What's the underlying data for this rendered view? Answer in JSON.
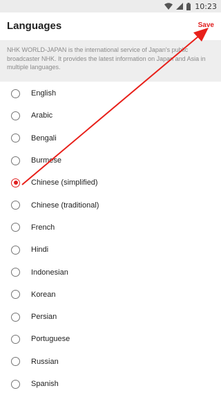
{
  "status_bar": {
    "time": "10:23"
  },
  "toolbar": {
    "title": "Languages",
    "save_label": "Save"
  },
  "description": "NHK WORLD-JAPAN is the international service of Japan's public broadcaster NHK. It provides the latest information on Japan and Asia in multiple languages.",
  "languages": {
    "selected": "Chinese (simplified)",
    "items": [
      {
        "label": "English",
        "checked": false
      },
      {
        "label": "Arabic",
        "checked": false
      },
      {
        "label": "Bengali",
        "checked": false
      },
      {
        "label": "Burmese",
        "checked": false
      },
      {
        "label": "Chinese (simplified)",
        "checked": true
      },
      {
        "label": "Chinese (traditional)",
        "checked": false
      },
      {
        "label": "French",
        "checked": false
      },
      {
        "label": "Hindi",
        "checked": false
      },
      {
        "label": "Indonesian",
        "checked": false
      },
      {
        "label": "Korean",
        "checked": false
      },
      {
        "label": "Persian",
        "checked": false
      },
      {
        "label": "Portuguese",
        "checked": false
      },
      {
        "label": "Russian",
        "checked": false
      },
      {
        "label": "Spanish",
        "checked": false
      }
    ]
  },
  "colors": {
    "accent": "#e02020",
    "status_bar": "#ececec",
    "description_bg": "#eeeeee"
  }
}
